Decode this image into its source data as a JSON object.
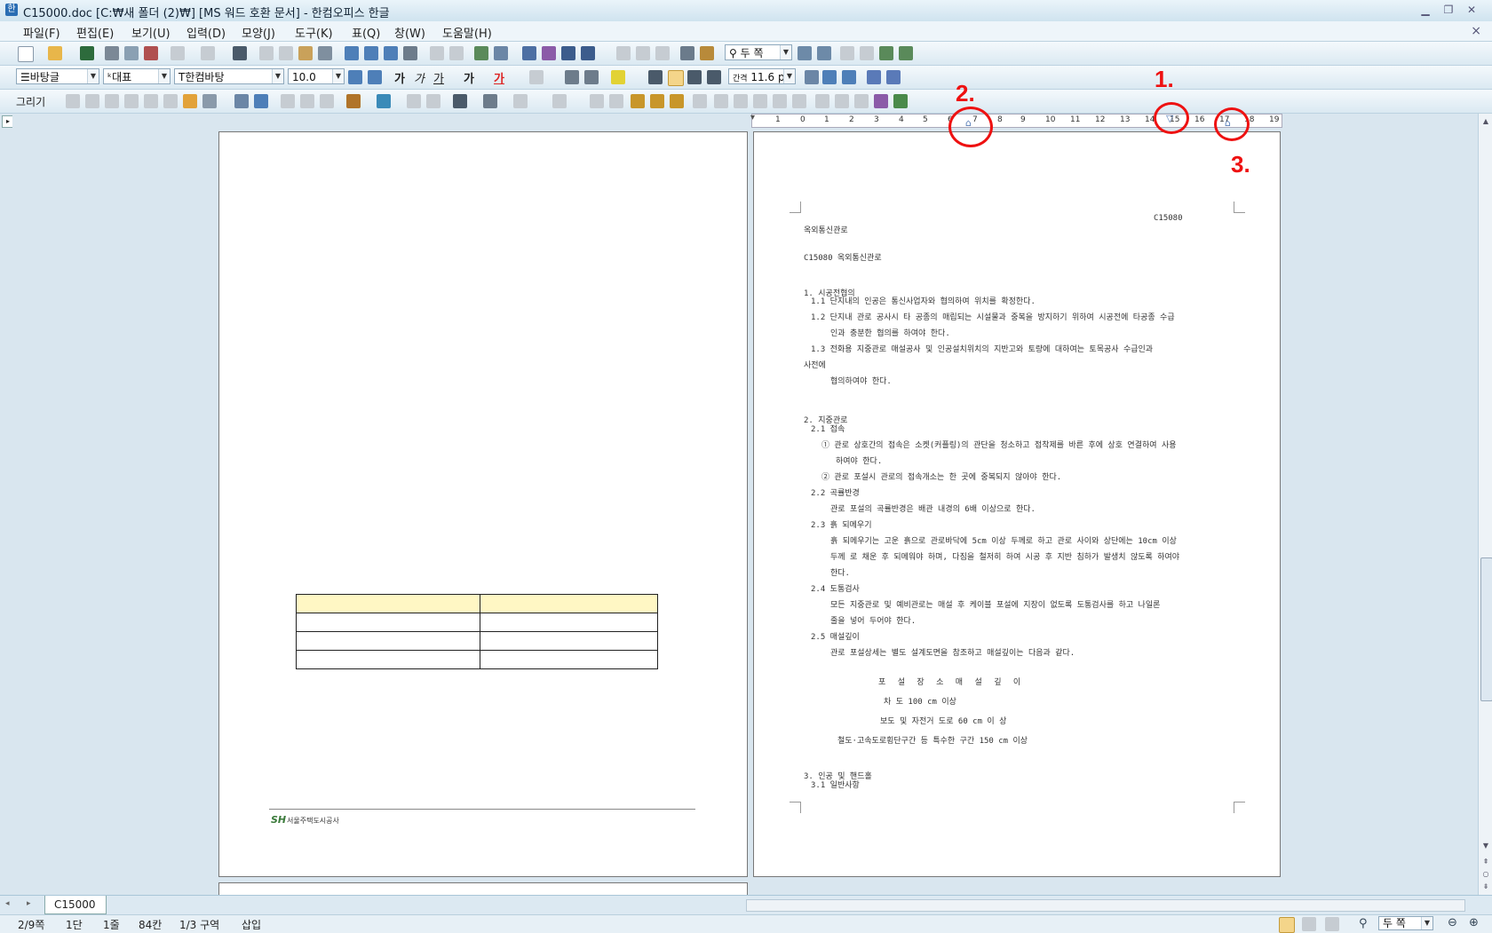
{
  "window": {
    "title": "C15000.doc [C:₩새 폴더 (2)₩] [MS 워드 호환 문서] - 한컴오피스 한글"
  },
  "menu": [
    "파일(F)",
    "편집(E)",
    "보기(U)",
    "입력(D)",
    "모양(J)",
    "도구(K)",
    "표(Q)",
    "창(W)",
    "도움말(H)"
  ],
  "format_bar": {
    "style": "바탕글",
    "lang": "대표",
    "font": "한컴바탕",
    "size": "10.0",
    "spacing": "11.6",
    "spacing_unit": "pt",
    "spacing_prefix": "간격",
    "bold_samples": [
      "가",
      "가",
      "가",
      "가",
      "가"
    ]
  },
  "view_bar": {
    "zoom": "두 쪽"
  },
  "draw_bar": {
    "label": "그리기"
  },
  "ruler": {
    "numbers": [
      "1",
      "0",
      "1",
      "2",
      "3",
      "4",
      "5",
      "6",
      "7",
      "8",
      "9",
      "10",
      "11",
      "12",
      "13",
      "14",
      "15",
      "16",
      "17",
      "18",
      "19"
    ]
  },
  "callouts": [
    {
      "label": "1."
    },
    {
      "label": "2."
    },
    {
      "label": "3."
    }
  ],
  "left_page": {
    "logo_text": "서울주택도시공사",
    "logo_mark": "SH"
  },
  "right_page": {
    "code": "C15080",
    "lines": [
      "옥외통신관로",
      "C15080 옥외통신관로",
      "1. 시공전협의",
      "1.1 단지내의 인공은 통신사업자와 협의하여 위치를 확정한다.",
      "1.2 단지내 관로 공사시 타 공종의 매립되는 시설물과 중복을 방지하기 위하여 시공전에 타공종 수급",
      "인과 충분한 협의를 하여야 한다.",
      "1.3 전화용 지중관로 매설공사 및 인공설치위치의 지반고와 토량에 대하여는 토목공사 수급인과",
      "사전에",
      "협의하여야 한다.",
      "2. 지중관로",
      "2.1 접속",
      "① 관로 상호간의 접속은 소켓(커플링)의 관단을 청소하고 접착제를 바른 후에 상호 연결하여 사용",
      "하여야 한다.",
      "② 관로 포설시 관로의 접속개소는 한 곳에 중복되지 않아야 한다.",
      "2.2 곡률반경",
      "관로 포설의 곡률반경은 배관 내경의 6배 이상으로 한다.",
      "2.3 흙 되메우기",
      "흙 되메우기는 고운 흙으로 관로바닥에 5cm 이상 두께로 하고 관로 사이와 상단에는 10cm 이상",
      "두께 로 채운 후 되메워야 하며, 다짐을 철저히 하여 시공 후 지반 침하가 발생치 않도록 하여야",
      "한다.",
      "2.4 도통검사",
      "모든 지중관로 및 예비관로는 매설 후 케이블 포설에 지장이 없도록 도통검사를 하고 나일론",
      "줄을 넣어 두어야 한다.",
      "2.5 매설깊이",
      "관로 포설상세는 별도 설계도면을 참조하고 매설깊이는 다음과 같다.",
      "포 설 장 소   매 설 깊 이",
      "차 도       100 cm 이상",
      "보도 및 자전거 도로   60 cm 이 상",
      "철도·고속도로횡단구간 등 특수한 구간   150 cm 이상",
      "3. 인공 및 핸드홀",
      "3.1 일반사항"
    ]
  },
  "tab": {
    "name": "C15000"
  },
  "status": {
    "page": "2/9쪽",
    "column": "1단",
    "line": "1줄",
    "char": "84칸",
    "section": "1/3 구역",
    "mode": "삽입",
    "zoom": "두 쪽"
  }
}
